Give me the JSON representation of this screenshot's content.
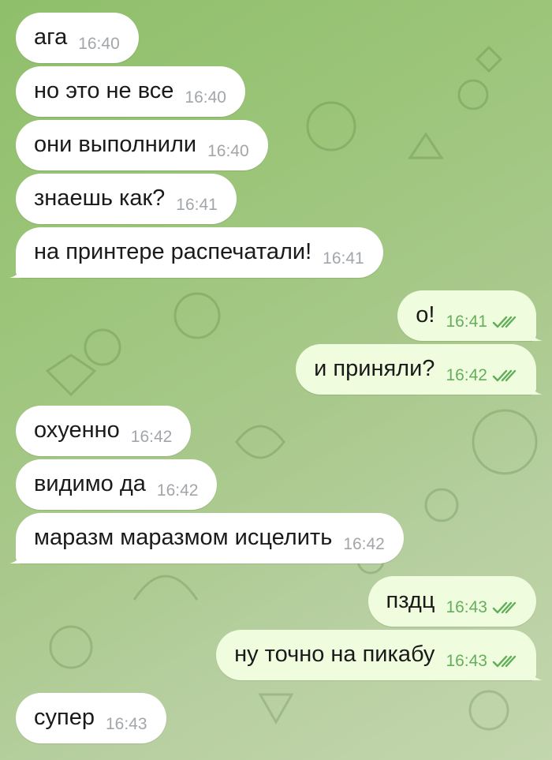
{
  "messages": [
    {
      "side": "in",
      "text": "ага",
      "time": "16:40"
    },
    {
      "side": "in",
      "text": "но это не все",
      "time": "16:40"
    },
    {
      "side": "in",
      "text": "они выполнили",
      "time": "16:40"
    },
    {
      "side": "in",
      "text": "знаешь как?",
      "time": "16:41"
    },
    {
      "side": "in",
      "text": "на принтере распечатали!",
      "time": "16:41"
    },
    {
      "side": "out",
      "text": "о!",
      "time": "16:41",
      "status": "read"
    },
    {
      "side": "out",
      "text": "и приняли?",
      "time": "16:42",
      "status": "read"
    },
    {
      "side": "in",
      "text": "охуенно",
      "time": "16:42"
    },
    {
      "side": "in",
      "text": "видимо да",
      "time": "16:42"
    },
    {
      "side": "in",
      "text": "маразм маразмом исцелить",
      "time": "16:42"
    },
    {
      "side": "out",
      "text": "пздц",
      "time": "16:43",
      "status": "read"
    },
    {
      "side": "out",
      "text": "ну точно на пикабу",
      "time": "16:43",
      "status": "read"
    },
    {
      "side": "in",
      "text": "супер",
      "time": "16:43"
    }
  ],
  "colors": {
    "incoming_bubble": "#ffffff",
    "outgoing_bubble": "#effdde",
    "outgoing_time": "#66ae5e",
    "incoming_time": "#a2a6aa",
    "wallpaper": "#9cc57a"
  }
}
